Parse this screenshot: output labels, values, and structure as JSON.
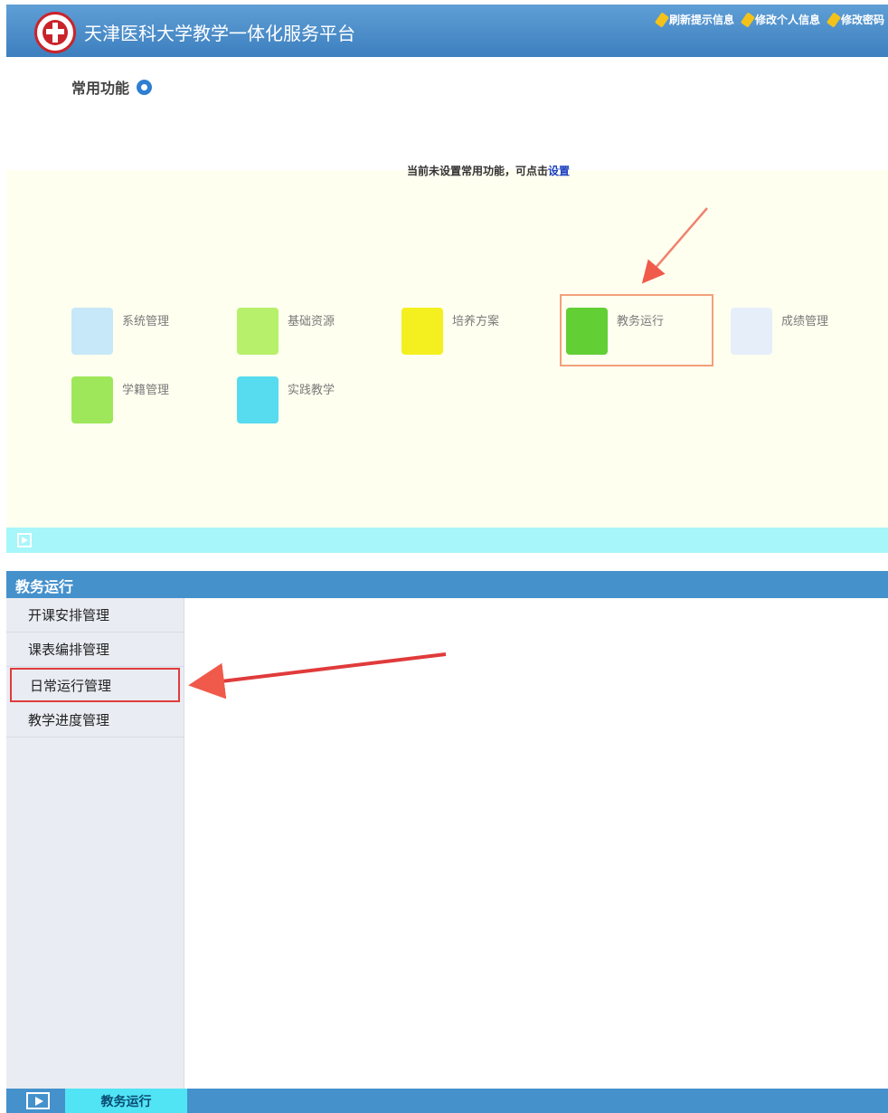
{
  "header": {
    "title": "天津医科大学教学一体化服务平台",
    "links": [
      "刷新提示信息",
      "修改个人信息",
      "修改密码"
    ]
  },
  "favorites": {
    "label": "常用功能",
    "empty_text": "当前未设置常用功能，可点击",
    "set_link": "设置"
  },
  "modules": [
    {
      "label": "系统管理",
      "icon": "system-icon",
      "color": "#c7e8f8"
    },
    {
      "label": "基础资源",
      "icon": "resource-icon",
      "color": "#b7f06a"
    },
    {
      "label": "培养方案",
      "icon": "plan-icon",
      "color": "#f4f020"
    },
    {
      "label": "教务运行",
      "icon": "academic-icon",
      "color": "#62cf35"
    },
    {
      "label": "成绩管理",
      "icon": "grade-icon",
      "color": "#e6eefa"
    },
    {
      "label": "学籍管理",
      "icon": "status-icon",
      "color": "#9ee75b"
    },
    {
      "label": "实践教学",
      "icon": "practice-icon",
      "color": "#57dbef"
    }
  ],
  "screen2": {
    "title": "教务运行",
    "menu": [
      "开课安排管理",
      "课表编排管理",
      "日常运行管理",
      "教学进度管理"
    ],
    "footer_tab": "教务运行"
  },
  "colors": {
    "header_blue": "#4591cc",
    "highlight_red": "#e03b3b"
  }
}
